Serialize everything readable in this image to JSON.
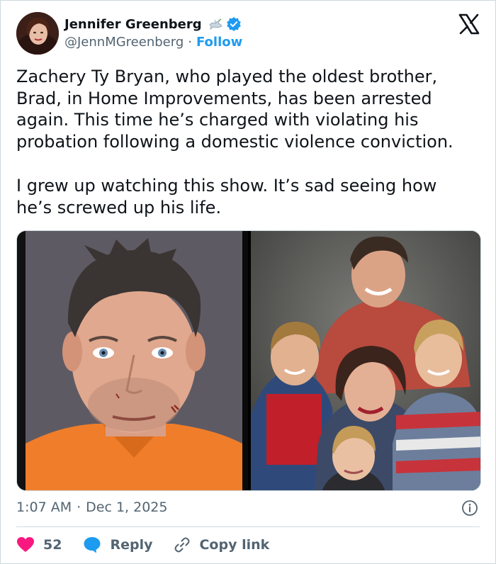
{
  "author": {
    "name": "Jennifer Greenberg",
    "handle": "@JennMGreenberg",
    "separator": "·",
    "follow_label": "Follow",
    "verified": true
  },
  "tweet": {
    "paragraphs": [
      "Zachery Ty Bryan, who played the oldest brother,\nBrad, in Home Improvements, has been arrested\nagain. This time he’s charged with violating his\nprobation following a domestic violence conviction.",
      "I grew up watching this show. It’s sad seeing how\nhe’s screwed up his life."
    ]
  },
  "meta": {
    "time": "1:07 AM",
    "separator": "·",
    "date": "Dec 1, 2025"
  },
  "actions": {
    "likes": "52",
    "reply_label": "Reply",
    "copy_label": "Copy link"
  },
  "colors": {
    "link": "#1d9bf0",
    "heart": "#f91880",
    "muted": "#536471"
  },
  "icons": [
    "x-logo-icon",
    "verified-badge-icon",
    "dove-emoji-icon",
    "info-icon",
    "heart-icon",
    "reply-bubble-icon",
    "link-icon"
  ]
}
